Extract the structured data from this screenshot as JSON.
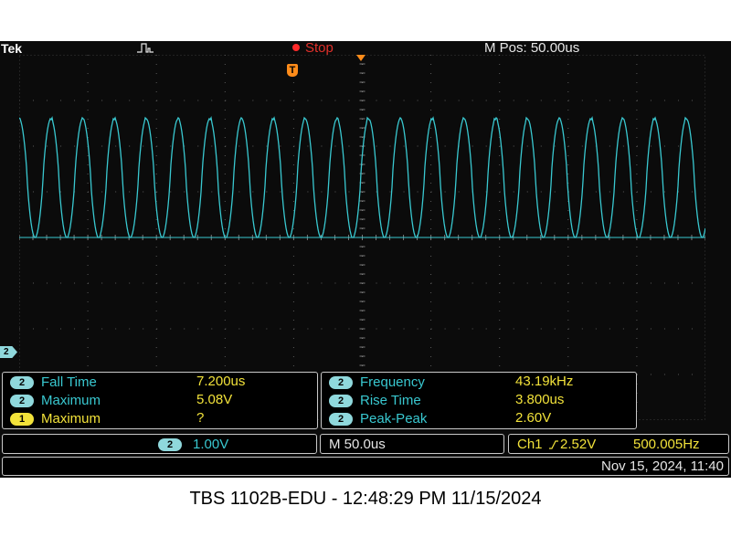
{
  "status_bar": {
    "brand": "Tek",
    "run_state": "Stop",
    "horizontal_position": "M Pos: 50.00us"
  },
  "markers": {
    "trigger_marker_label": "T",
    "ch2_ground_label": "2"
  },
  "waveform": {
    "channel": "2",
    "color": "#39c8d0",
    "cycles_on_screen": 21.6
  },
  "measurements_left": [
    {
      "channel": "2",
      "name": "Fall Time",
      "value": "7.200us"
    },
    {
      "channel": "2",
      "name": "Maximum",
      "value": "5.08V"
    },
    {
      "channel": "1",
      "name": "Maximum",
      "value": "?"
    }
  ],
  "measurements_right": [
    {
      "channel": "2",
      "name": "Frequency",
      "value": "43.19kHz"
    },
    {
      "channel": "2",
      "name": "Rise Time",
      "value": "3.800us"
    },
    {
      "channel": "2",
      "name": "Peak-Peak",
      "value": "2.60V"
    }
  ],
  "vertical": {
    "channel": "2",
    "scale": "1.00V"
  },
  "horizontal": {
    "timebase": "M 50.0us"
  },
  "trigger": {
    "source": "Ch1",
    "level": "2.52V",
    "frequency": "500.005Hz"
  },
  "datetime": "Nov 15, 2024, 11:40",
  "caption": "TBS 1102B-EDU - 12:48:29 PM   11/15/2024",
  "colors": {
    "ch1": "#f2e23a",
    "ch2": "#39c8d0",
    "trigger": "#ff8c1a",
    "stop": "#e0302a",
    "background": "#0b0b0b"
  }
}
